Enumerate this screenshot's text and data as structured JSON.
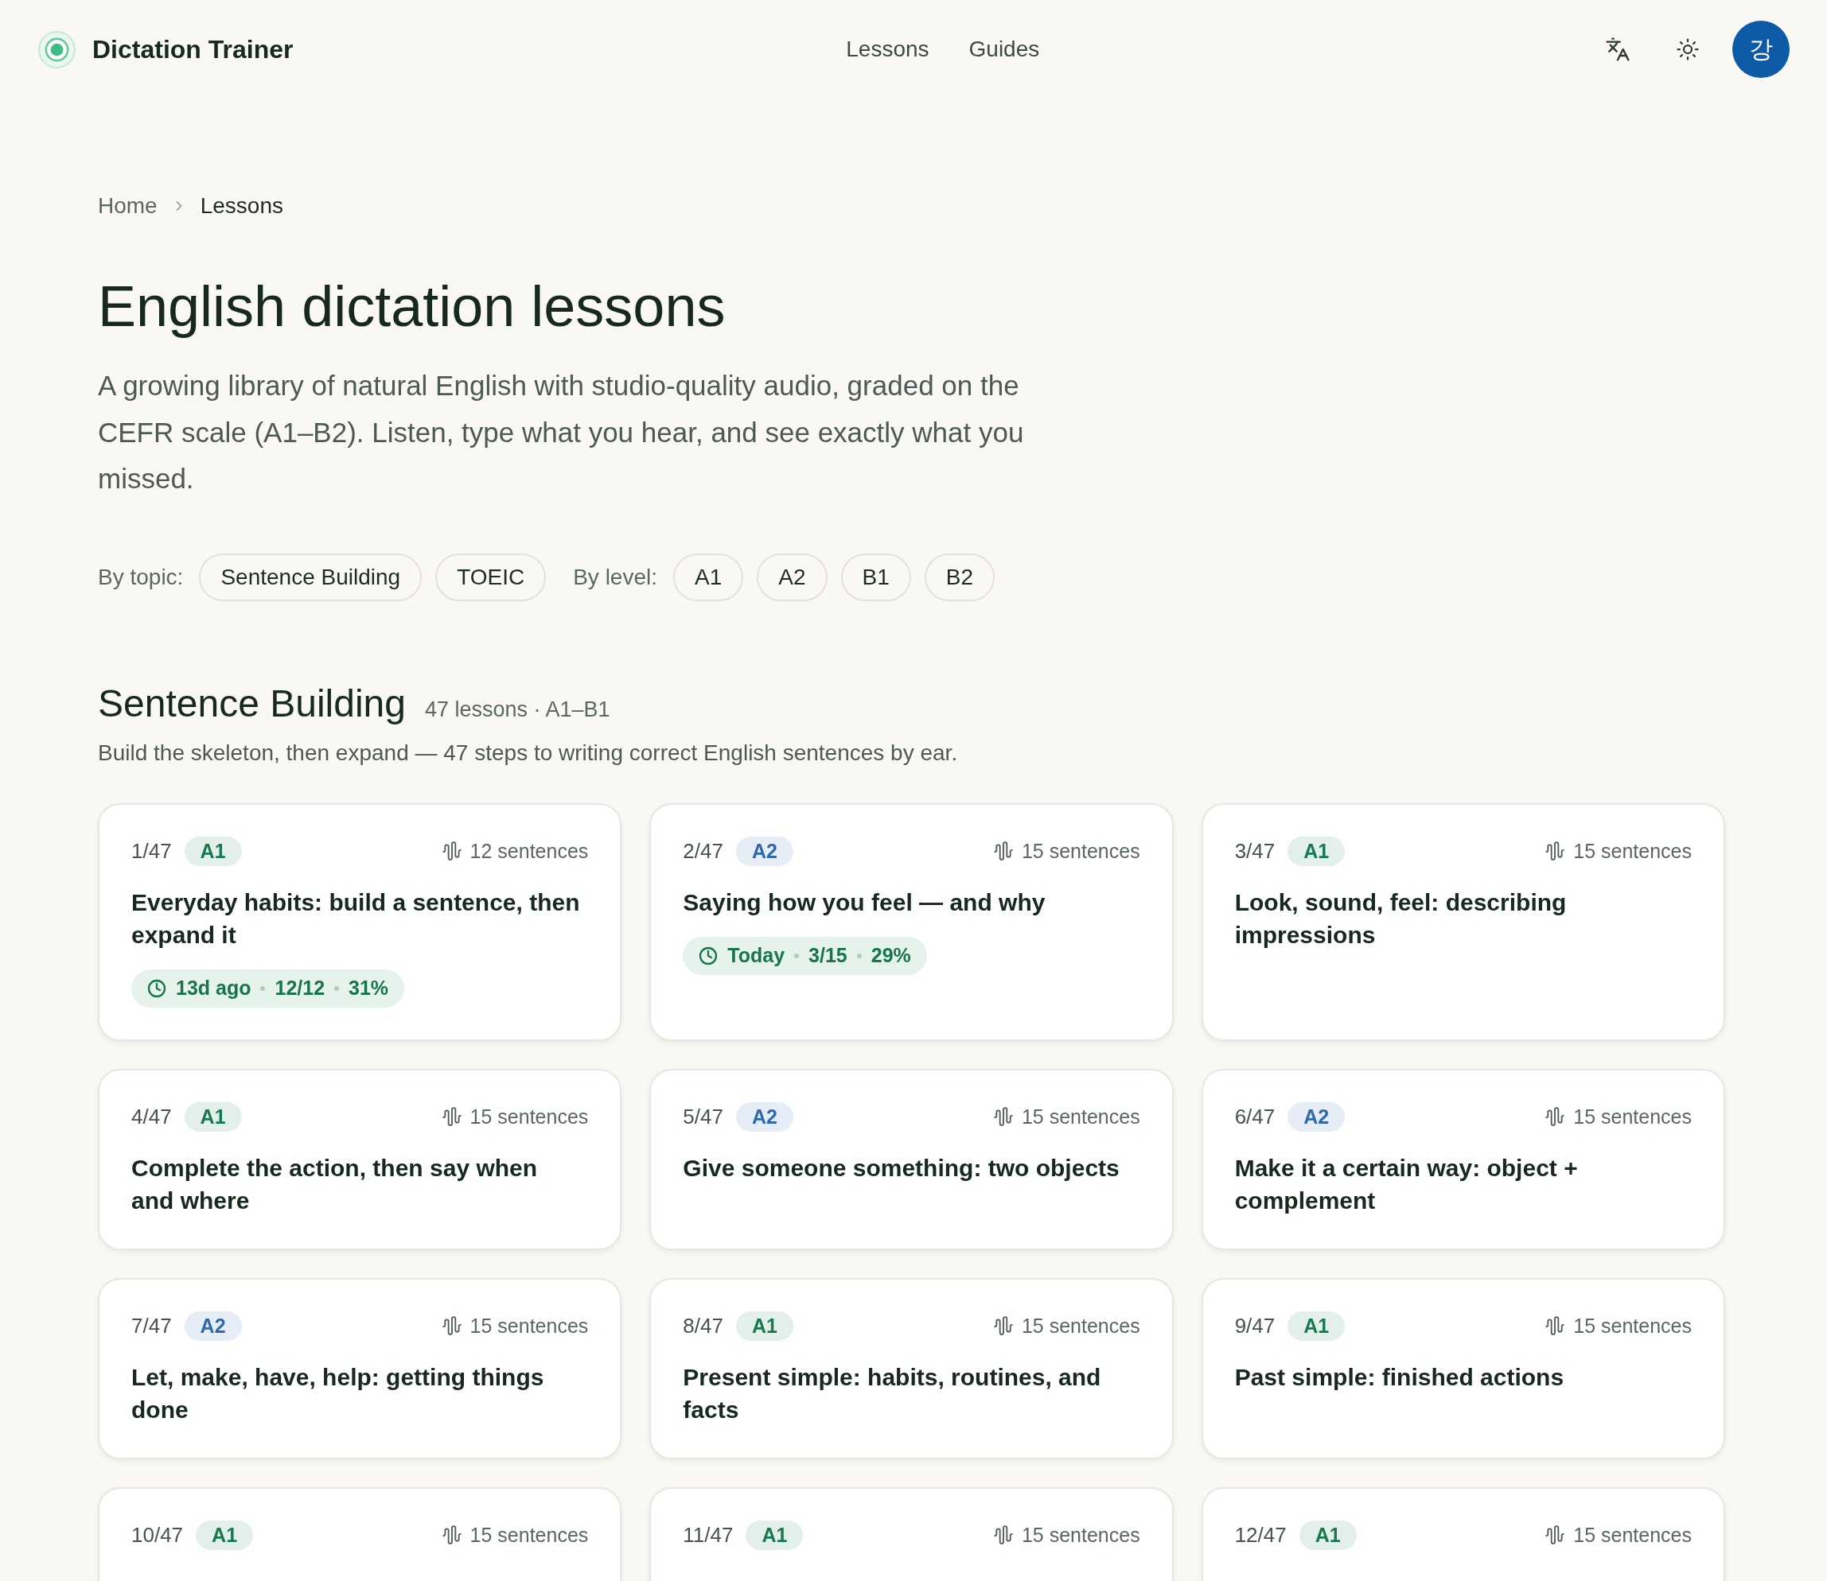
{
  "header": {
    "app_title": "Dictation Trainer",
    "nav": [
      {
        "label": "Lessons"
      },
      {
        "label": "Guides"
      }
    ],
    "avatar": "강"
  },
  "breadcrumb": [
    {
      "label": "Home",
      "current": false
    },
    {
      "label": "Lessons",
      "current": true
    }
  ],
  "page": {
    "title": "English dictation lessons",
    "intro": "A growing library of natural English with studio-quality audio, graded on the CEFR scale (A1–B2). Listen, type what you hear, and see exactly what you missed."
  },
  "filters": [
    {
      "label": "By topic:",
      "chips": [
        {
          "label": "Sentence Building",
          "selected": false
        },
        {
          "label": "TOEIC",
          "selected": false
        }
      ]
    },
    {
      "label": "By level:",
      "chips": [
        {
          "label": "A1",
          "selected": false
        },
        {
          "label": "A2",
          "selected": false
        },
        {
          "label": "B1",
          "selected": false
        },
        {
          "label": "B2",
          "selected": false
        }
      ]
    }
  ],
  "section": {
    "title": "Sentence Building",
    "meta": "47 lessons · A1–B1",
    "description": "Build the skeleton, then expand — 47 steps to writing correct English sentences by ear.",
    "lessons": [
      {
        "number": "1/47",
        "level": {
          "label": "A1",
          "color": "#177a4f"
        },
        "sentences": "12 sentences",
        "title": "Everyday habits: build a sentence, then expand it",
        "progress": {
          "when": "13d ago",
          "done": "12/12",
          "score": "31%"
        }
      },
      {
        "number": "2/47",
        "level": {
          "label": "A2",
          "color": "#2f69b0"
        },
        "sentences": "15 sentences",
        "title": "Saying how you feel — and why",
        "progress": {
          "when": "Today",
          "done": "3/15",
          "score": "29%"
        }
      },
      {
        "number": "3/47",
        "level": {
          "label": "A1",
          "color": "#177a4f"
        },
        "sentences": "15 sentences",
        "title": "Look, sound, feel: describing impressions"
      },
      {
        "number": "4/47",
        "level": {
          "label": "A1",
          "color": "#177a4f"
        },
        "sentences": "15 sentences",
        "title": "Complete the action, then say when and where"
      },
      {
        "number": "5/47",
        "level": {
          "label": "A2",
          "color": "#2f69b0"
        },
        "sentences": "15 sentences",
        "title": "Give someone something: two objects"
      },
      {
        "number": "6/47",
        "level": {
          "label": "A2",
          "color": "#2f69b0"
        },
        "sentences": "15 sentences",
        "title": "Make it a certain way: object + complement"
      },
      {
        "number": "7/47",
        "level": {
          "label": "A2",
          "color": "#2f69b0"
        },
        "sentences": "15 sentences",
        "title": "Let, make, have, help: getting things done"
      },
      {
        "number": "8/47",
        "level": {
          "label": "A1",
          "color": "#177a4f"
        },
        "sentences": "15 sentences",
        "title": "Present simple: habits, routines, and facts"
      },
      {
        "number": "9/47",
        "level": {
          "label": "A1",
          "color": "#177a4f"
        },
        "sentences": "15 sentences",
        "title": "Past simple: finished actions"
      },
      {
        "number": "10/47",
        "level": {
          "label": "A1",
          "color": "#177a4f"
        },
        "sentences": "15 sentences"
      },
      {
        "number": "11/47",
        "level": {
          "label": "A1",
          "color": "#177a4f"
        },
        "sentences": "15 sentences"
      },
      {
        "number": "12/47",
        "level": {
          "label": "A1",
          "color": "#177a4f"
        },
        "sentences": "15 sentences"
      }
    ]
  }
}
